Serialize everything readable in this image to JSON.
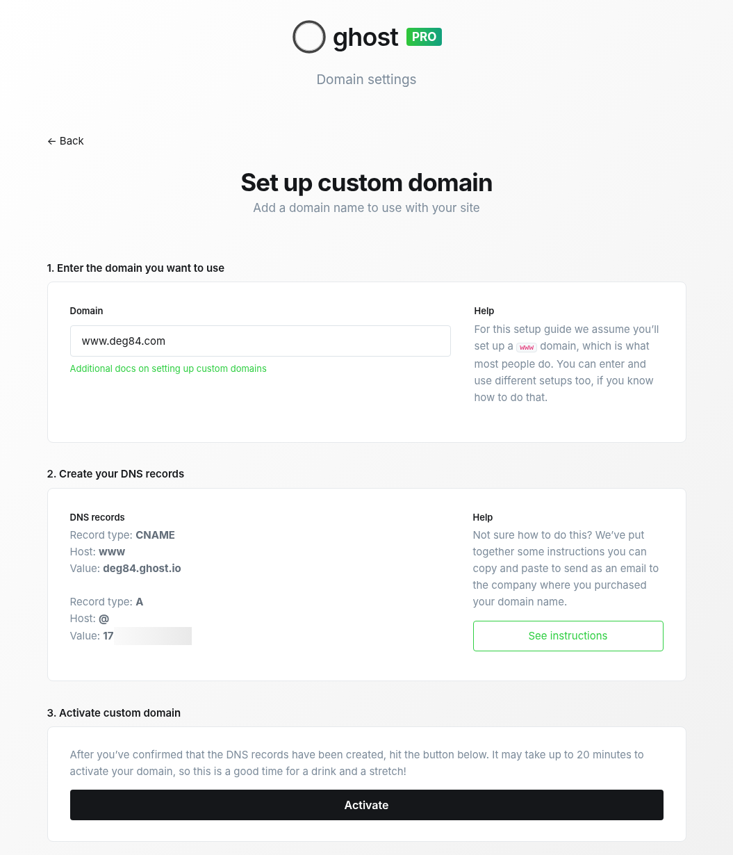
{
  "header": {
    "logo_text": "ghost",
    "badge": "PRO",
    "subtitle": "Domain settings"
  },
  "back": {
    "label": "Back",
    "arrow": "←"
  },
  "title": "Set up custom domain",
  "subtitle": "Add a domain name to use with your site",
  "step1": {
    "heading": "1. Enter the domain you want to use",
    "field_label": "Domain",
    "value": "www.deg84.com",
    "link": "Additional docs on setting up custom domains",
    "help_title": "Help",
    "help_before": "For this setup guide we assume you’ll set up a",
    "help_code": "www",
    "help_after": "domain, which is what most people do. You can enter and use different setups too, if you know how to do that."
  },
  "step2": {
    "heading": "2. Create your DNS records",
    "records_title": "DNS records",
    "groups": [
      {
        "lines": [
          "Record type: **CNAME**",
          "Host: **www**",
          "Value: **deg84.ghost.io**"
        ],
        "redacted": false
      },
      {
        "lines": [
          "Record type: **A**",
          "Host: **@**",
          "Value: **17**"
        ],
        "redacted": true
      }
    ],
    "help_title": "Help",
    "help_text": "Not sure how to do this? We’ve put together some instructions you can copy and paste to send as an email to the company where you purchased your domain name.",
    "button": "See instructions"
  },
  "step3": {
    "heading": "3. Activate custom domain",
    "text": "After you’ve confirmed that the DNS records have been created, hit the button below. It may take up to 20 minutes to activate your domain, so this is a good time for a drink and a stretch!",
    "button": "Activate"
  }
}
